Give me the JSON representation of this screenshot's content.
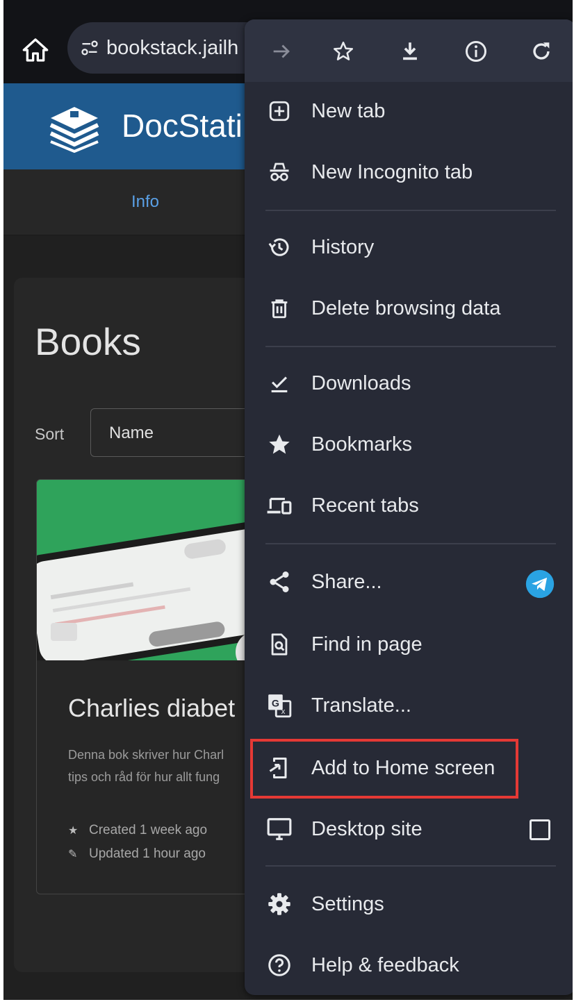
{
  "address_bar": {
    "url": "bookstack.jailh"
  },
  "site": {
    "name": "DocStati",
    "tab": "Info"
  },
  "books_page": {
    "title": "Books",
    "sort_label": "Sort",
    "sort_value": "Name",
    "book": {
      "title": "Charlies diabet",
      "description_line1": "Denna bok skriver hur Charl",
      "description_line2": "tips och råd för hur allt fung",
      "created": "Created 1 week ago",
      "updated": "Updated 1 hour ago"
    }
  },
  "menu": {
    "items": {
      "new_tab": "New tab",
      "new_incognito_tab": "New Incognito tab",
      "history": "History",
      "delete_browsing_data": "Delete browsing data",
      "downloads": "Downloads",
      "bookmarks": "Bookmarks",
      "recent_tabs": "Recent tabs",
      "share": "Share...",
      "find_in_page": "Find in page",
      "translate": "Translate...",
      "add_to_home_screen": "Add to Home screen",
      "desktop_site": "Desktop site",
      "settings": "Settings",
      "help_feedback": "Help & feedback"
    },
    "desktop_site_checked": false,
    "highlight_color": "#e53935"
  }
}
